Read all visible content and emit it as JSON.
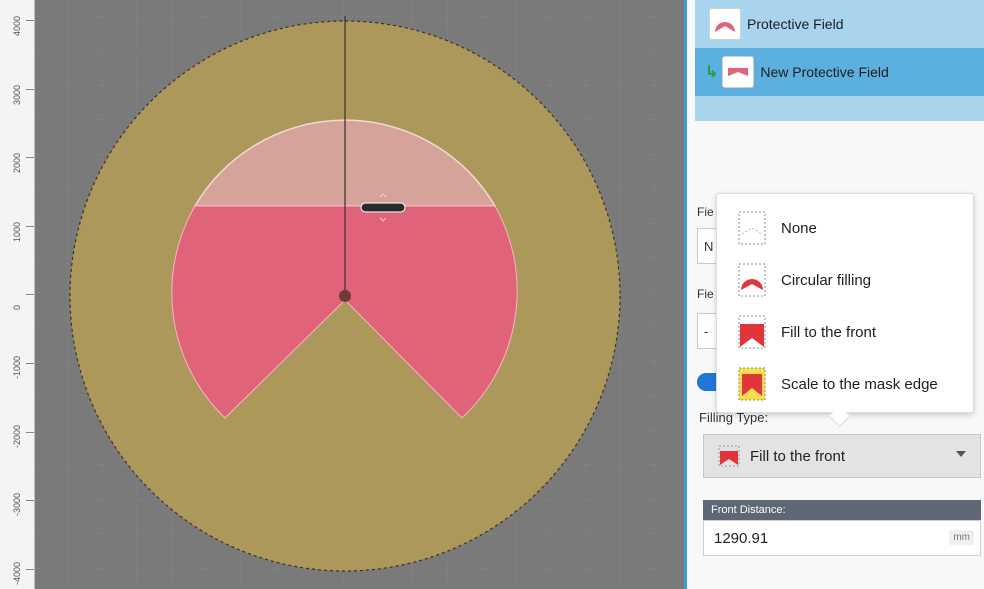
{
  "canvas": {
    "y_axis_ticks": [
      "4000",
      "3000",
      "2000",
      "1000",
      "0",
      "-1000",
      "-2000",
      "-3000",
      "-4000"
    ]
  },
  "field_list": {
    "items": [
      {
        "label": "Protective Field",
        "icon": "protective-field-icon"
      },
      {
        "label": "New Protective Field",
        "icon": "new-protective-field-icon"
      }
    ]
  },
  "partial_labels": {
    "field_label_1": "Fie",
    "field_value_1": "N",
    "field_label_2": "Fie",
    "field_value_2": "-"
  },
  "filling_type": {
    "label": "Filling Type:",
    "selected": "Fill to the front",
    "options": [
      {
        "label": "None",
        "icon": "none-fill-icon"
      },
      {
        "label": "Circular filling",
        "icon": "circular-filling-icon"
      },
      {
        "label": "Fill to the front",
        "icon": "fill-to-front-icon"
      },
      {
        "label": "Scale to the mask edge",
        "icon": "scale-to-mask-edge-icon"
      }
    ]
  },
  "front_distance": {
    "label": "Front Distance:",
    "value": "1290.91",
    "unit": "mm"
  },
  "colors": {
    "canvas_bg": "#7a7a7a",
    "outer_field": "#b09a5a",
    "protective_field": "#e0637a",
    "preview_field": "#d6a39a",
    "selection": "#5cb0e0",
    "toggle": "#1f78d8"
  }
}
